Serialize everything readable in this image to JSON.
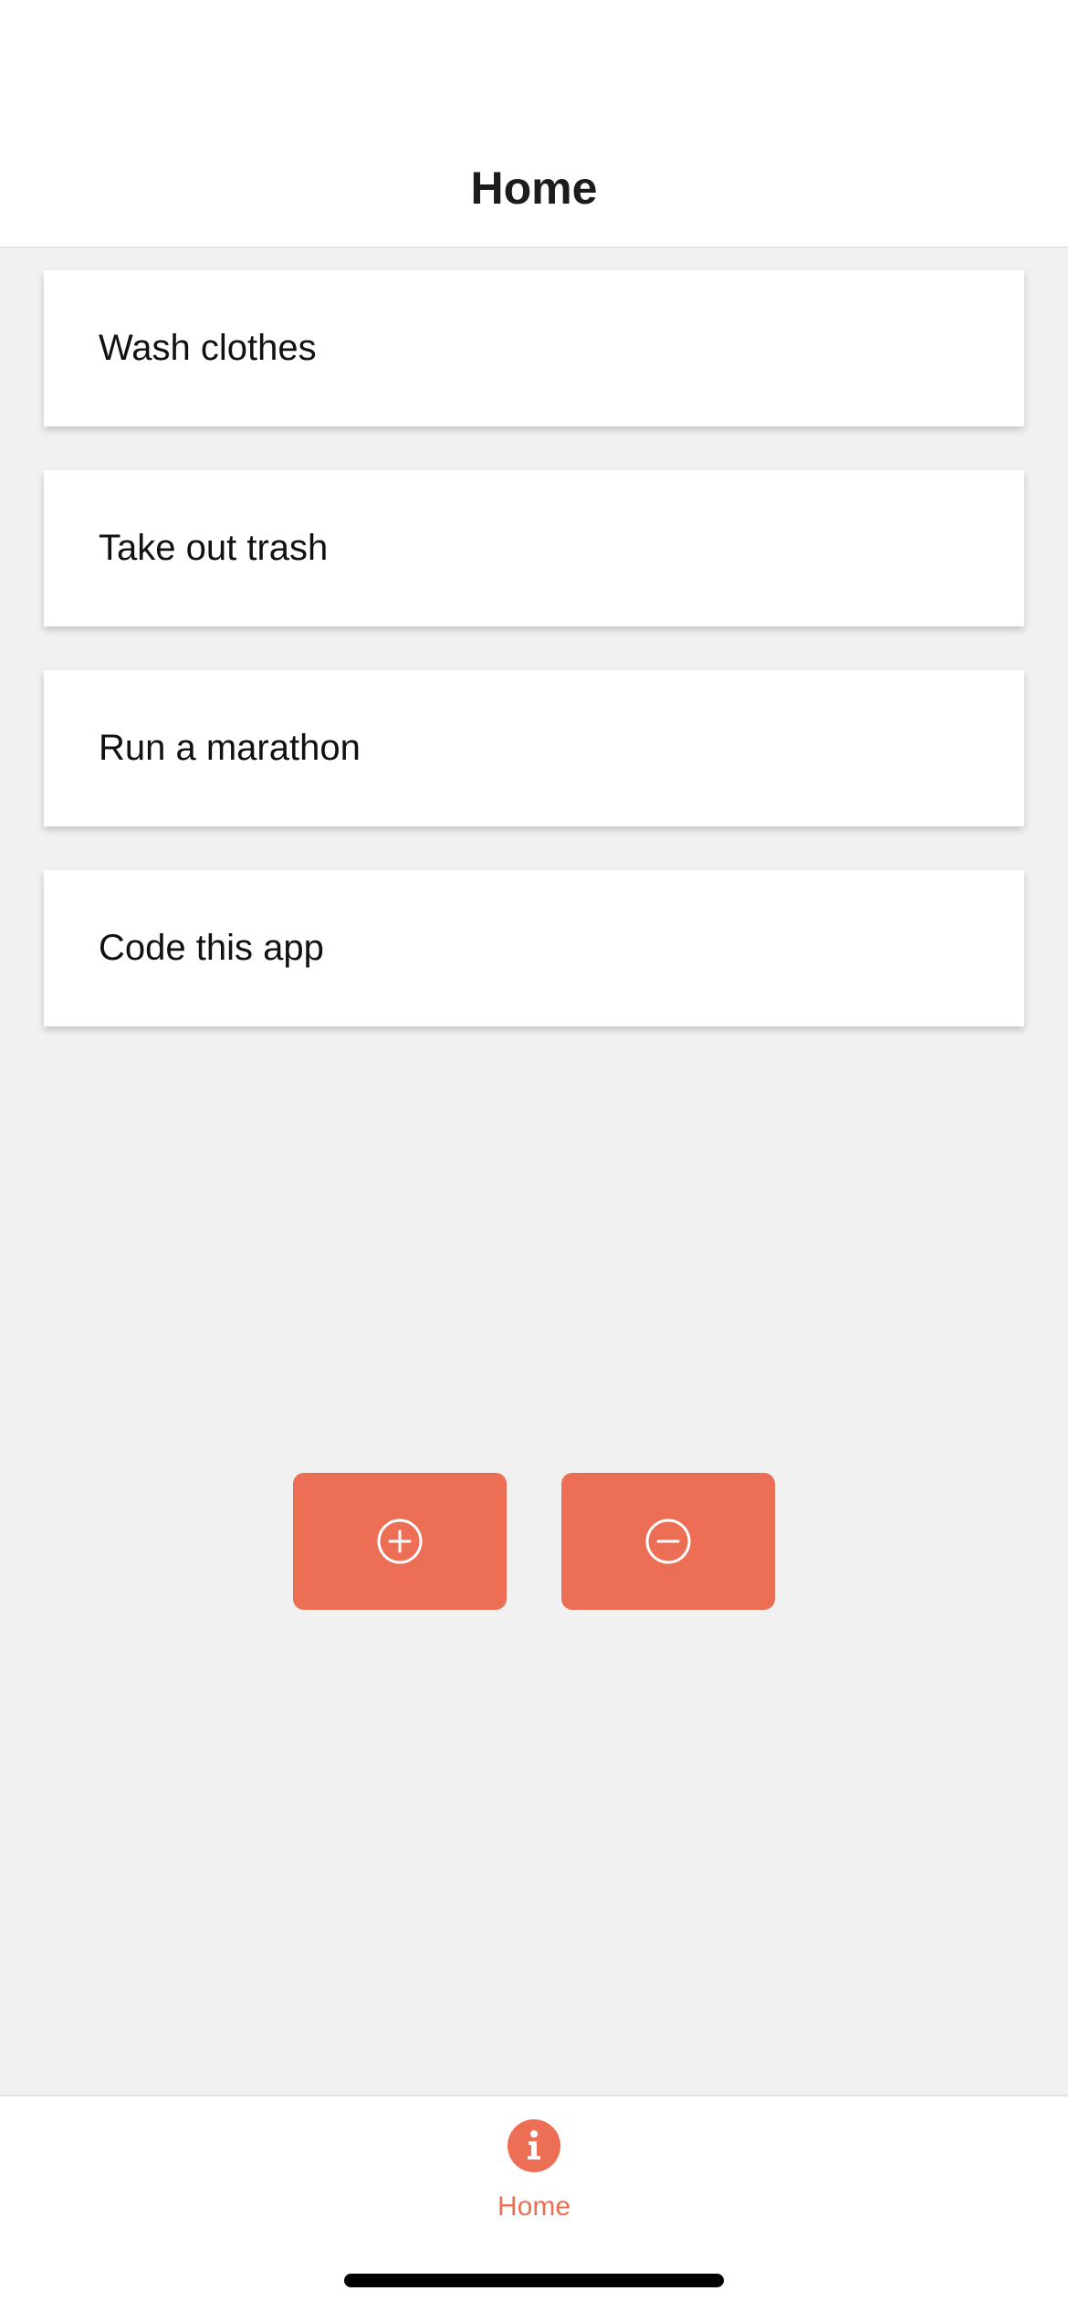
{
  "header": {
    "title": "Home"
  },
  "tasks": [
    {
      "label": "Wash clothes"
    },
    {
      "label": "Take out trash"
    },
    {
      "label": "Run a marathon"
    },
    {
      "label": "Code this app"
    }
  ],
  "actions": {
    "add_icon": "plus-circle-icon",
    "remove_icon": "minus-circle-icon"
  },
  "tabbar": {
    "tabs": [
      {
        "label": "Home",
        "icon": "info-icon",
        "active": true
      }
    ]
  },
  "colors": {
    "accent": "#ec6e55",
    "background": "#f1f1f1",
    "card": "#ffffff",
    "text": "#111111"
  }
}
